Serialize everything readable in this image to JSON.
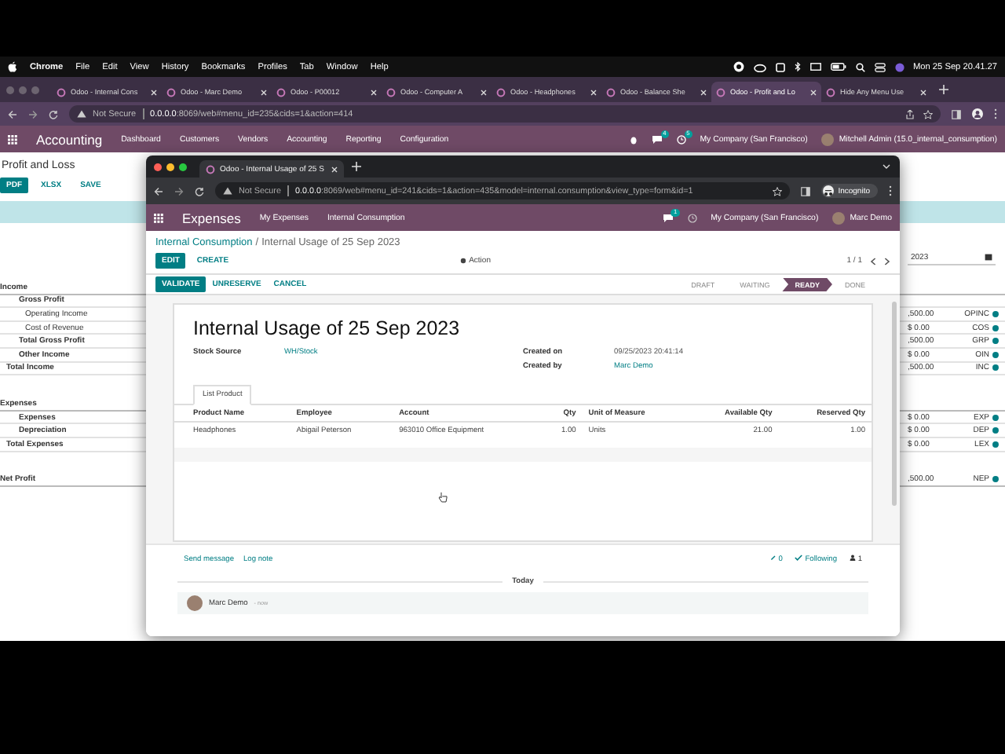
{
  "menubar": {
    "app": "Chrome",
    "items": [
      "File",
      "Edit",
      "View",
      "History",
      "Bookmarks",
      "Profiles",
      "Tab",
      "Window",
      "Help"
    ],
    "clock": "Mon 25 Sep  20.41.27"
  },
  "back_browser": {
    "tabs": [
      {
        "title": "Odoo - Internal Cons",
        "selected": false
      },
      {
        "title": "Odoo - Marc Demo",
        "selected": false
      },
      {
        "title": "Odoo - P00012",
        "selected": false
      },
      {
        "title": "Odoo - Computer A",
        "selected": false
      },
      {
        "title": "Odoo - Headphones",
        "selected": false
      },
      {
        "title": "Odoo - Balance She",
        "selected": false
      },
      {
        "title": "Odoo - Profit and Lo",
        "selected": true
      },
      {
        "title": "Hide Any Menu Use",
        "selected": false
      }
    ],
    "security": "Not Secure",
    "url_host": "0.0.0.0",
    "url_rest": ":8069/web#menu_id=235&cids=1&action=414",
    "navbar": {
      "app": "Accounting",
      "menu": [
        "Dashboard",
        "Customers",
        "Vendors",
        "Accounting",
        "Reporting",
        "Configuration"
      ],
      "messages": "4",
      "activities": "5",
      "company": "My Company (San Francisco)",
      "user": "Mitchell Admin (15.0_internal_consumption)"
    },
    "page": {
      "title": "Profit and Loss",
      "buttons": [
        {
          "label": "PDF",
          "kind": "primary"
        },
        {
          "label": "XLSX",
          "kind": "link"
        },
        {
          "label": "SAVE",
          "kind": "link"
        }
      ],
      "date_filter": "2023",
      "rows": [
        {
          "label": "Income",
          "kind": "section",
          "children": [
            {
              "label": "Gross Profit",
              "kind": "line",
              "children": [
                {
                  "label": "Operating Income",
                  "kind": "line",
                  "value": ",500.00",
                  "code": "OPINC"
                },
                {
                  "label": "Cost of Revenue",
                  "kind": "line",
                  "value": "$ 0.00",
                  "code": "COS"
                }
              ]
            },
            {
              "label": "Total Gross Profit",
              "kind": "line",
              "value": ",500.00",
              "code": "GRP"
            },
            {
              "label": "Other Income",
              "kind": "line",
              "value": "$ 0.00",
              "code": "OIN"
            },
            {
              "label": "Total Income",
              "kind": "total",
              "value": ",500.00",
              "code": "INC"
            }
          ]
        },
        {
          "label": "Expenses",
          "kind": "section",
          "children": [
            {
              "label": "Expenses",
              "kind": "line",
              "value": "$ 0.00",
              "code": "EXP"
            },
            {
              "label": "Depreciation",
              "kind": "line",
              "value": "$ 0.00",
              "code": "DEP"
            },
            {
              "label": "Total Expenses",
              "kind": "total",
              "value": "$ 0.00",
              "code": "LEX"
            }
          ]
        },
        {
          "label": "Net Profit",
          "kind": "section",
          "value": ",500.00",
          "code": "NEP"
        }
      ]
    }
  },
  "front_browser": {
    "tab": "Odoo - Internal Usage of 25 S",
    "security": "Not Secure",
    "url_host": "0.0.0.0",
    "url_rest": ":8069/web#menu_id=241&cids=1&action=435&model=internal.consumption&view_type=form&id=1",
    "profile": "Incognito",
    "navbar": {
      "app": "Expenses",
      "menu": [
        "My Expenses",
        "Internal Consumption"
      ],
      "messages": "1",
      "company": "My Company (San Francisco)",
      "user": "Marc Demo"
    },
    "breadcrumb": {
      "parent": "Internal Consumption",
      "separator": "/",
      "current": "Internal Usage of 25 Sep 2023"
    },
    "buttons": [
      {
        "label": "EDIT",
        "kind": "primary"
      },
      {
        "label": "CREATE",
        "kind": "link"
      }
    ],
    "action": "Action",
    "pager": "1 / 1",
    "state_buttons": [
      {
        "label": "VALIDATE",
        "kind": "primary"
      },
      {
        "label": "UNRESERVE",
        "kind": "link"
      },
      {
        "label": "CANCEL",
        "kind": "link"
      }
    ],
    "statuses": [
      {
        "label": "DRAFT",
        "selected": false
      },
      {
        "label": "WAITING",
        "selected": false
      },
      {
        "label": "READY",
        "selected": true
      },
      {
        "label": "DONE",
        "selected": false
      }
    ],
    "form": {
      "title": "Internal Usage of 25 Sep 2023",
      "left_fields": [
        {
          "label": "Stock Source",
          "value": "WH/Stock"
        }
      ],
      "right_fields": [
        {
          "label": "Created on",
          "value": "09/25/2023 20:41:14",
          "kind": "text"
        },
        {
          "label": "Created by",
          "value": "Marc Demo",
          "kind": "link"
        }
      ],
      "notebook_tab": "List Product",
      "columns": [
        {
          "label": "Product Name",
          "numeric": false
        },
        {
          "label": "Employee",
          "numeric": false
        },
        {
          "label": "Account",
          "numeric": false
        },
        {
          "label": "Qty",
          "numeric": true
        },
        {
          "label": "Unit of Measure",
          "numeric": false
        },
        {
          "label": "Available Qty",
          "numeric": true
        },
        {
          "label": "Reserved Qty",
          "numeric": true
        }
      ],
      "rows": [
        [
          "Headphones",
          "Abigail Peterson",
          "963010 Office Equipment",
          "1.00",
          "Units",
          "21.00",
          "1.00"
        ]
      ]
    },
    "chatter": {
      "actions": [
        "Send message",
        "Log note"
      ],
      "attachments": "0",
      "following": "Following",
      "followers": "1",
      "date": "Today",
      "message": {
        "author": "Marc Demo",
        "time": "- now"
      }
    }
  }
}
